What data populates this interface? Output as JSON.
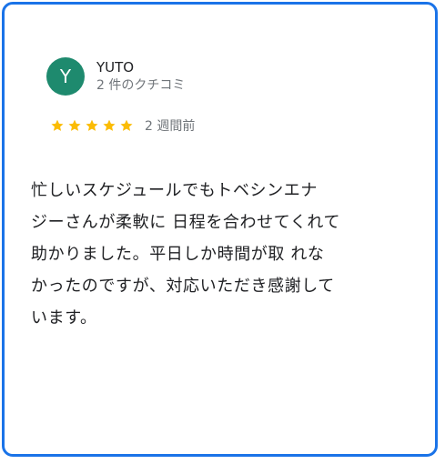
{
  "review": {
    "author": {
      "initial": "Y",
      "name": "YUTO",
      "review_count": "2 件のクチコミ",
      "avatar_color": "#1e8a6e"
    },
    "rating": {
      "stars": 5,
      "max": 5,
      "star_color": "#fbbc04",
      "time": "2 週間前"
    },
    "text": "忙しいスケジュールでもトベシンエナ\nジーさんが柔軟に 日程を合わせてくれて\n助かりました。平日しか時間が取 れな\nかったのですが、対応いただき感謝して\nいます。"
  },
  "card": {
    "border_color": "#1a73e8"
  }
}
